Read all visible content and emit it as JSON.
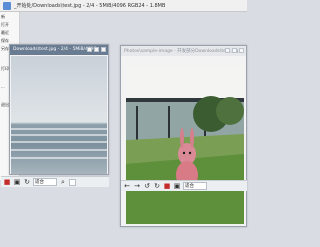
{
  "titlebar": {
    "title": "_开始处/Downloads\\test.jpg - 2/4 - 5MiB/4096 RGB24 - 1.8MB"
  },
  "menu": {
    "items": [
      "新",
      "打开",
      "最近",
      "保存",
      "另存为",
      "打印",
      "...",
      "退出"
    ]
  },
  "left_window": {
    "title": "Downloads\\test.jpg - 2/4 - 5MiB/4096"
  },
  "right_window": {
    "title": "Photos\\sample-image - 开发部分Downloads\\test.jpg"
  },
  "toolbar": {
    "fit_left": "适合",
    "fit_right": "适合"
  },
  "icons": {
    "left_toolbar": [
      "crop-icon",
      "transform-icon",
      "rotate-icon"
    ],
    "right_toolbar": [
      "prev-icon",
      "next-icon",
      "rotate-left-icon",
      "rotate-right-icon",
      "grid-icon",
      "crop-icon"
    ]
  },
  "colors": {
    "accent": "#5b8dd6",
    "window_active": "#6a7c92"
  }
}
